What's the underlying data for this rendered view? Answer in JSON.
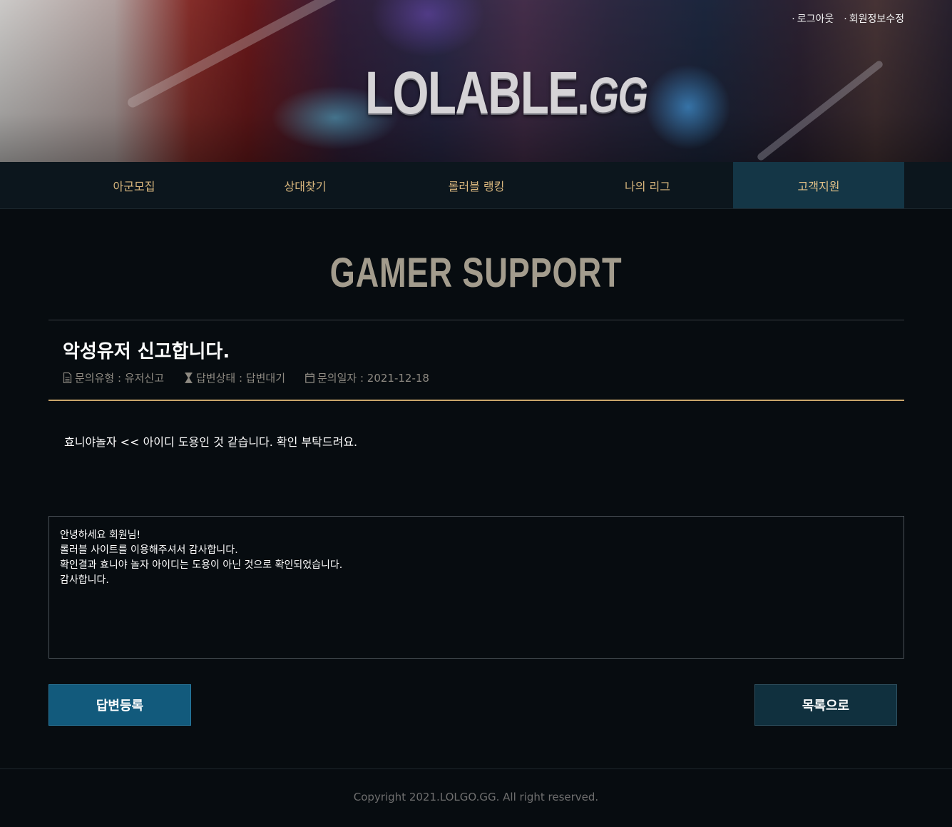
{
  "header": {
    "logo": {
      "main": "LOLABLE",
      "dot": ".",
      "tld": "GG"
    },
    "top_links": [
      "로그아웃",
      "회원정보수정"
    ]
  },
  "nav": {
    "items": [
      {
        "label": "아군모집"
      },
      {
        "label": "상대찾기"
      },
      {
        "label": "롤러블 랭킹"
      },
      {
        "label": "나의 리그"
      },
      {
        "label": "고객지원",
        "active": true
      }
    ]
  },
  "page": {
    "title": "GAMER SUPPORT"
  },
  "post": {
    "title": "악성유저 신고합니다.",
    "meta": {
      "type_label": "문의유형 : 유저신고",
      "status_label": "답변상태 : 답변대기",
      "date_label": "문의일자 : 2021-12-18"
    },
    "body": "효니야놀자 << 아이디 도용인 것 같습니다. 확인 부탁드려요."
  },
  "answer": {
    "lines": [
      "안녕하세요 회원님!",
      "롤러블 사이트를 이용해주셔서 감사합니다.",
      "확인결과 효니야 놀자 아이디는 도용이 아닌 것으로 확인되었습니다.",
      "감사합니다."
    ]
  },
  "buttons": {
    "submit_label": "답변등록",
    "list_label": "목록으로"
  },
  "footer": {
    "copyright": "Copyright 2021.LOLGO.GG. All right reserved."
  },
  "colors": {
    "accent_gold": "#c9a66b",
    "nav_active": "#143646",
    "button_primary": "#125a7c",
    "background": "#070c10"
  }
}
